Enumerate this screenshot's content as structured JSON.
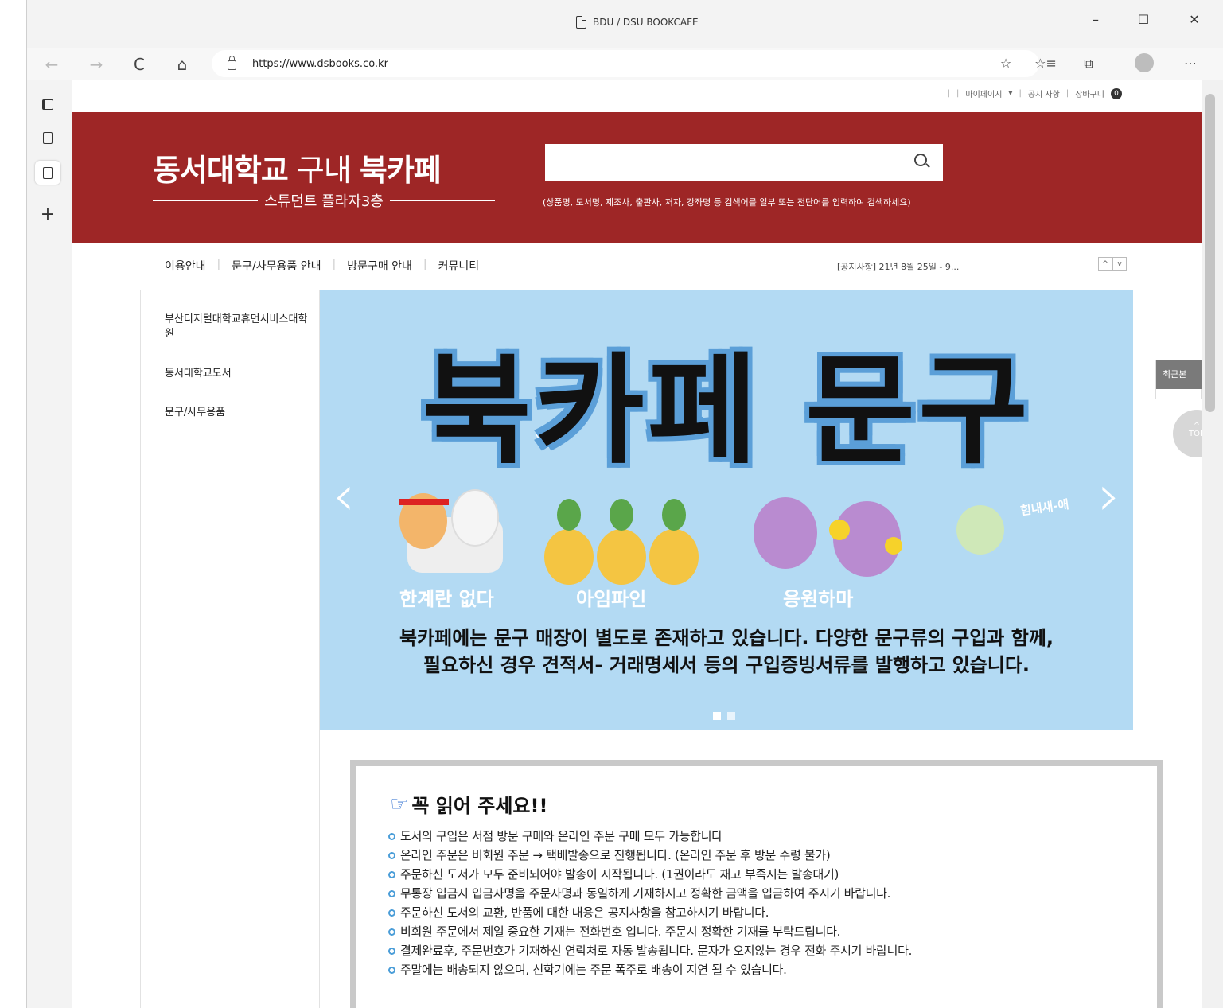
{
  "window": {
    "title": "BDU / DSU BOOKCAFE",
    "controls": [
      "–",
      "☐",
      "✕"
    ]
  },
  "toolbar": {
    "back_icon": "←",
    "forward_icon": "→",
    "refresh_icon": "C",
    "home_icon": "⌂",
    "url": "https://www.dsbooks.co.kr",
    "icons": [
      "☆",
      "☆≡",
      "⧉",
      "⋯"
    ]
  },
  "vertical_tabs": {
    "new_tab_icon": "+"
  },
  "topnav": {
    "separator": "|",
    "mypage": "마이페이지",
    "notice": "공지 사항",
    "cart": "장바구니",
    "cart_count": "0"
  },
  "header": {
    "logo_line1_a": "동서대학교",
    "logo_line1_b": " 구내 ",
    "logo_line1_c": "북카페",
    "logo_line2": "스튜던트 플라자3층",
    "search_hint": "(상품명, 도서명, 제조사, 출판사, 저자, 강좌명 등 검색어를 일부 또는 전단어를 입력하여 검색하세요)"
  },
  "mainnav": {
    "items": [
      "이용안내",
      "문구/사무용품 안내",
      "방문구매 안내",
      "커뮤니티"
    ],
    "notice_ticker": "[공지사항] 21년 8월 25일 - 9...",
    "up_arrow": "^",
    "down_arrow": "v"
  },
  "categories": [
    "부산디지털대학교휴먼서비스대학원",
    "동서대학교도서",
    "문구/사무용품"
  ],
  "banner": {
    "title": "북카페 문구",
    "prev_arrow": "‹",
    "next_arrow": "›",
    "sticker_labels": [
      "한계란 없다",
      "아임파인",
      "응원하마"
    ],
    "hand_label": "힘내새-애",
    "desc_line1": "북카페에는 문구 매장이 별도로 존재하고 있습니다. 다양한 문구류의 구입과 함께,",
    "desc_line2": "필요하신 경우 견적서- 거래명세서 등의 구입증빙서류를 발행하고 있습니다.",
    "slide_count": 2
  },
  "side_widgets": {
    "recent_label": "최근본",
    "top_label": "TOP",
    "top_arrow": "^"
  },
  "notice_box": {
    "title": "꼭 읽어 주세요!!",
    "items": [
      "도서의 구입은 서점 방문 구매와 온라인 주문 구매 모두 가능합니다",
      "온라인 주문은 비회원 주문 → 택배발송으로 진행됩니다. (온라인 주문 후 방문 수령 불가)",
      "주문하신 도서가 모두 준비되어야 발송이 시작됩니다. (1권이라도 재고 부족시는 발송대기)",
      "무통장 입금시 입금자명을 주문자명과 동일하게 기재하시고 정확한 금액을 입금하여 주시기 바랍니다.",
      "주문하신 도서의 교환, 반품에 대한 내용은 공지사항을 참고하시기 바랍니다.",
      "비회원 주문에서 제일 중요한 기재는 전화번호 입니다. 주문시 정확한 기재를 부탁드립니다.",
      "결제완료후, 주문번호가 기재하신 연락처로 자동 발송됩니다. 문자가 오지않는 경우 전화 주시기 바랍니다.",
      "주말에는 배송되지 않으며, 신학기에는 주문 폭주로 배송이 지연 될 수 있습니다."
    ]
  },
  "colors": {
    "header_red": "#9e2626",
    "banner_blue": "#b3daf3",
    "bullet_blue": "#4a9dd8"
  }
}
